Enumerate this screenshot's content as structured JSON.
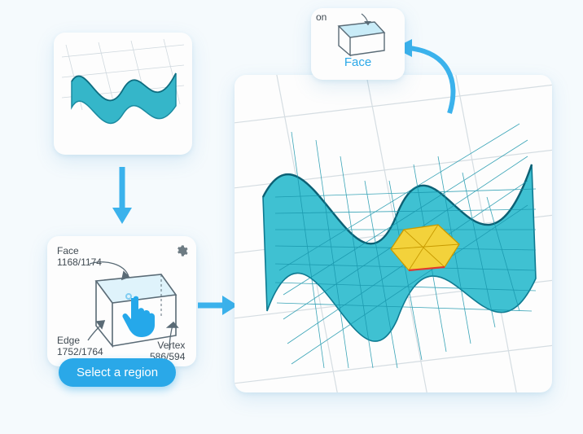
{
  "preview": {
    "alt": "wavy surface preview"
  },
  "selector": {
    "face_label": "Face",
    "face_count": "1168/1174",
    "edge_label": "Edge",
    "edge_count": "1752/1764",
    "vertex_label": "Vertex",
    "vertex_count": "586/594",
    "gear_icon": "settings"
  },
  "tooltip": {
    "text": "Select a region"
  },
  "face_popup": {
    "label": "Face",
    "partial_text": "on"
  },
  "viewport": {
    "alt": "wavy surface wireframe with selected yellow region"
  },
  "arrows": {
    "down": "down-arrow",
    "right": "right-arrow",
    "curve": "curved-arrow"
  }
}
